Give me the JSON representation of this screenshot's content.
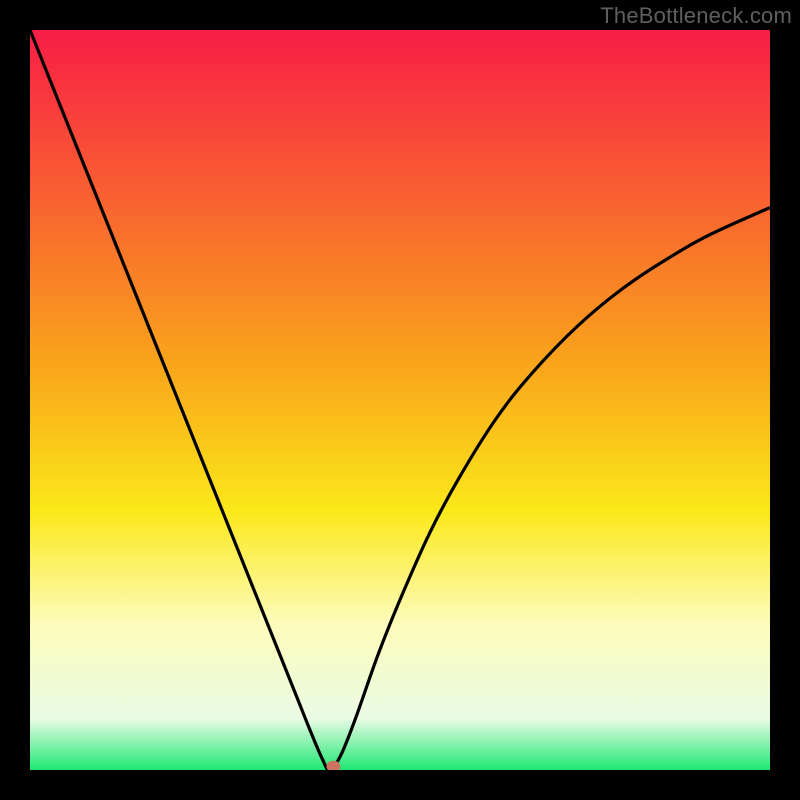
{
  "watermark": "TheBottleneck.com",
  "chart_data": {
    "type": "line",
    "title": "",
    "xlabel": "",
    "ylabel": "",
    "xlim": [
      0,
      100
    ],
    "ylim": [
      0,
      100
    ],
    "background_gradient": {
      "stops": [
        {
          "offset": 0,
          "color": "#f81d46"
        },
        {
          "offset": 45,
          "color": "#f9a41b"
        },
        {
          "offset": 65,
          "color": "#fbe81a"
        },
        {
          "offset": 80,
          "color": "#fdfcb9"
        },
        {
          "offset": 93,
          "color": "#eafce5"
        },
        {
          "offset": 100,
          "color": "#1fe874"
        }
      ]
    },
    "curve": {
      "description": "V-shaped bottleneck curve",
      "x": [
        0,
        3,
        6,
        9,
        12,
        15,
        18,
        21,
        24,
        27,
        30,
        33,
        36,
        38,
        39.5,
        40.5,
        42,
        44,
        47,
        50,
        54,
        58,
        63,
        68,
        74,
        80,
        86,
        92,
        100
      ],
      "y": [
        100,
        92.5,
        85,
        77.5,
        70,
        62.5,
        55,
        47.5,
        40,
        32.5,
        25,
        17.5,
        10,
        5,
        1.5,
        0,
        2,
        7,
        15.5,
        23,
        32,
        39.5,
        47.5,
        53.8,
        60,
        65,
        69,
        72.4,
        76
      ]
    },
    "marker": {
      "x": 41,
      "y": 0.5,
      "color": "#ce7361"
    }
  }
}
